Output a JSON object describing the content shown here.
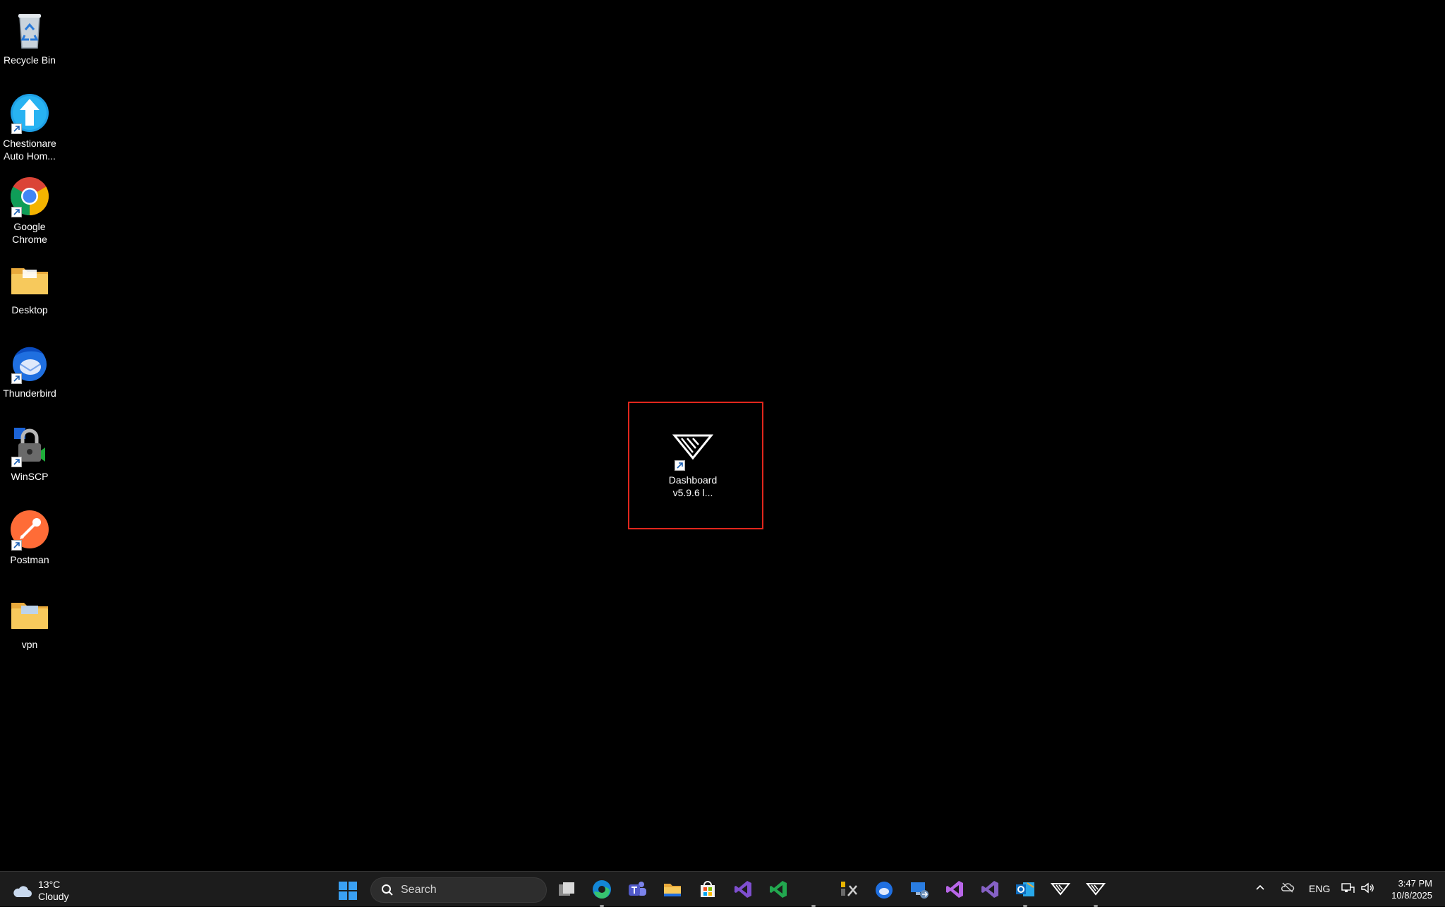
{
  "desktop": {
    "icons": [
      {
        "label": "Recycle Bin"
      },
      {
        "label": "Chestionare Auto Hom..."
      },
      {
        "label": "Google Chrome"
      },
      {
        "label": "Desktop"
      },
      {
        "label": "Thunderbird"
      },
      {
        "label": "WinSCP"
      },
      {
        "label": "Postman"
      },
      {
        "label": "vpn"
      }
    ],
    "selected_icon": {
      "label": "Dashboard v5.9.6   l..."
    }
  },
  "taskbar": {
    "weather": {
      "temp": "13°C",
      "condition": "Cloudy"
    },
    "search_placeholder": "Search",
    "pinned_apps": [
      "task-view",
      "edge",
      "teams",
      "file-explorer",
      "microsoft-store",
      "visual-studio",
      "visual-studio-code",
      "tools",
      "thunderbird",
      "remote-desktop",
      "visual-studio-2",
      "visual-studio-3",
      "outlook",
      "dashboard",
      "dashboard-2"
    ],
    "tray": {
      "language": "ENG"
    },
    "clock": {
      "time": "3:47 PM",
      "date": "10/8/2025"
    }
  },
  "colors": {
    "selection": "#e1261c",
    "taskbar_bg": "#1c1c1c",
    "desktop_bg": "#000000"
  }
}
